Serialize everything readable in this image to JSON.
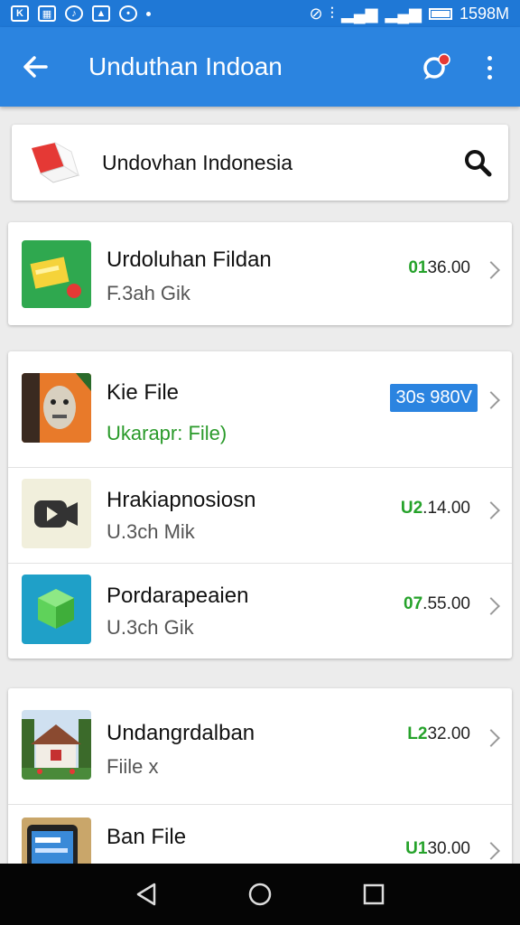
{
  "status_bar": {
    "time": "1598M",
    "left_icons": [
      "k-icon",
      "grid-icon",
      "music-icon",
      "image-icon",
      "shield-icon"
    ]
  },
  "app_bar": {
    "title": "Unduthan Indoan"
  },
  "search": {
    "text": "Undovhan Indonesia"
  },
  "items": [
    {
      "title": "Urdoluhan Fildan",
      "subtitle": "F.3ah Gik",
      "amount_prefix": "01",
      "amount_value": "36.00",
      "thumb": "green-folder-icon"
    },
    {
      "title": "Kie File",
      "subtitle": "Ukarapr: File)",
      "badge": "30ѕ 980V",
      "thumb": "portrait-image"
    },
    {
      "title": "Hrakiapnosiosn",
      "subtitle": "U.3ch Mik",
      "amount_prefix": "U2",
      "amount_value": ".14.00",
      "thumb": "video-camera-icon"
    },
    {
      "title": "Pordarapeaien",
      "subtitle": "U.3ch Gik",
      "amount_prefix": "07",
      "amount_value": ".55.00",
      "thumb": "cube-icon"
    },
    {
      "title": "Undangrdalban",
      "subtitle": "Fiile x",
      "amount_prefix": "L2",
      "amount_value": "32.00",
      "thumb": "house-image"
    },
    {
      "title": "Ban File",
      "subtitle": "",
      "amount_prefix": "U1",
      "amount_value": "30.00",
      "thumb": "phone-image"
    }
  ],
  "colors": {
    "app_bar": "#2b84e0",
    "status_bar": "#1f78d6",
    "badge": "#2b84e0",
    "amount_prefix": "#25a22a",
    "subtitle_green": "#2a9a2a"
  }
}
